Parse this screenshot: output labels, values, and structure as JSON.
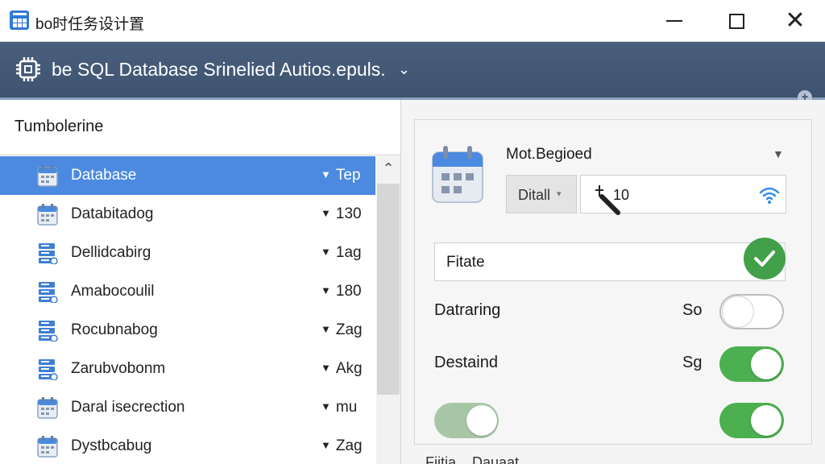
{
  "window": {
    "title": "bo时任务设计置",
    "close_glyph": "✕"
  },
  "header": {
    "title": "be SQL Database Srinelied Autios.epuls.",
    "chevron": "⌄",
    "plus": "+"
  },
  "sidebar": {
    "heading": "Tumbolerine",
    "selected_index": 0,
    "items": [
      {
        "label": "Database",
        "value": "Tep",
        "icon": "calendar-icon"
      },
      {
        "label": "Databitadog",
        "value": "130",
        "icon": "calendar-icon"
      },
      {
        "label": "Dellidcabirg",
        "value": "1ag",
        "icon": "server-icon"
      },
      {
        "label": "Amabocoulil",
        "value": "180",
        "icon": "server-icon"
      },
      {
        "label": "Rocubnabog",
        "value": "Zag",
        "icon": "server-icon"
      },
      {
        "label": "Zarubvobonm",
        "value": "Akg",
        "icon": "server-icon"
      },
      {
        "label": "Daral isecrection",
        "value": "mu",
        "icon": "calendar-icon"
      },
      {
        "label": "Dystbcabug",
        "value": "Zag",
        "icon": "calendar-icon"
      }
    ],
    "triangle": "▼",
    "scroll_up": "⌃"
  },
  "panel": {
    "region_label": "Mot.Begioed",
    "region_caret": "▼",
    "detail_dropdown": "Ditall",
    "detail_caret": "▾",
    "number_value": "10",
    "text_value": "Fitate",
    "settings": [
      {
        "label": "Datraring",
        "short": "So",
        "state": "off"
      },
      {
        "label": "Destaind",
        "short": "Sg",
        "state": "on"
      }
    ],
    "extra_toggles": [
      {
        "state": "on-light"
      },
      {
        "state": "on"
      }
    ],
    "footer_text": "Fiitia... Dauaat"
  },
  "colors": {
    "header_bg": "#4a5f7c",
    "selected_row": "#4b8ae0",
    "toggle_on": "#4caf50",
    "check_badge": "#43a04a",
    "wifi": "#2f8be6"
  }
}
